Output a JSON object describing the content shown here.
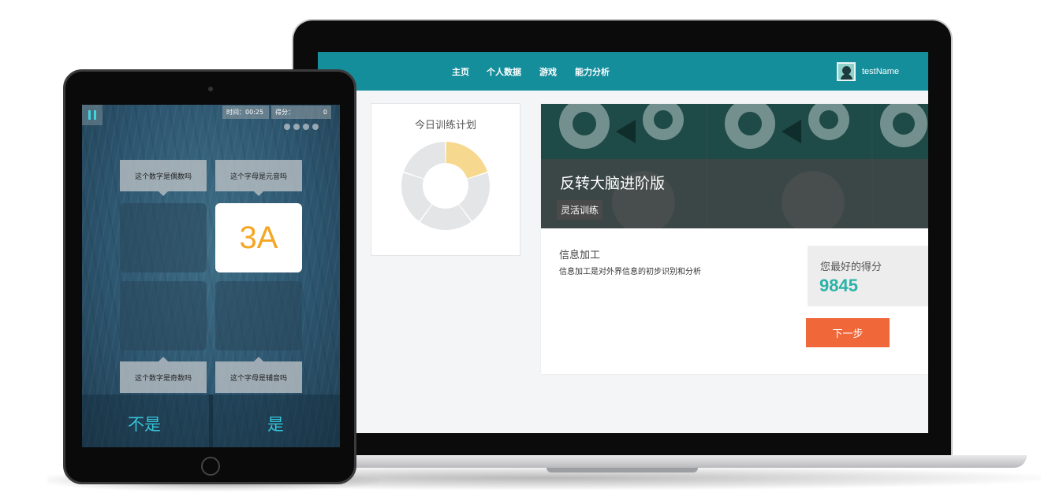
{
  "laptop": {
    "nav": {
      "items": [
        "主页",
        "个人数据",
        "游戏",
        "能力分析"
      ],
      "username": "testName"
    },
    "plan": {
      "title": "今日训练计划",
      "donut_segments": [
        {
          "fraction": 0.2,
          "color": "#f6d98f"
        },
        {
          "fraction": 0.2,
          "color": "#e4e5e7"
        },
        {
          "fraction": 0.2,
          "color": "#e4e5e7"
        },
        {
          "fraction": 0.2,
          "color": "#e4e5e7"
        },
        {
          "fraction": 0.2,
          "color": "#e4e5e7"
        }
      ]
    },
    "game": {
      "title": "反转大脑进阶版",
      "tag": "灵活训练",
      "info_title": "信息加工",
      "info_desc": "信息加工是对外界信息的初步识别和分析",
      "best_label": "您最好的得分",
      "best_score": "9845",
      "next_button": "下一步"
    }
  },
  "tablet": {
    "time_text": "时间：00:25",
    "score_text": "得分：",
    "score_value": "0",
    "questions": {
      "top_left": "这个数字是偶数吗",
      "top_right": "这个字母是元音吗",
      "bottom_left": "这个数字是奇数吗",
      "bottom_right": "这个字母是辅音吗"
    },
    "card_text": "3A",
    "answers": {
      "no": "不是",
      "yes": "是"
    }
  }
}
